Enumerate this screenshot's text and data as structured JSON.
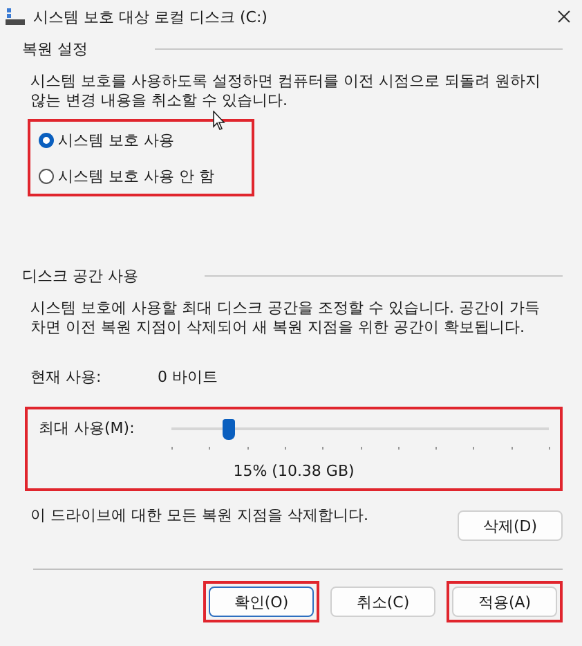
{
  "window": {
    "title": "시스템 보호 대상 로컬 디스크 (C:)"
  },
  "restore_settings": {
    "heading": "복원 설정",
    "description": "시스템 보호를 사용하도록 설정하면 컴퓨터를 이전 시점으로 되돌려 원하지 않는 변경 내용을 취소할 수 있습니다.",
    "highlighted": true,
    "options": [
      {
        "label": "시스템 보호 사용",
        "selected": true
      },
      {
        "label": "시스템 보호 사용 안 함",
        "selected": false
      }
    ]
  },
  "disk_space": {
    "heading": "디스크 공간 사용",
    "description": "시스템 보호에 사용할 최대 디스크 공간을 조정할 수 있습니다. 공간이 가득 차면 이전 복원 지점이 삭제되어 새 복원 지점을 위한 공간이 확보됩니다.",
    "current_label": "현재 사용:",
    "current_value": "0 바이트",
    "max_label": "최대 사용(M):",
    "level": 0.15,
    "reading": "15% (10.38 GB)",
    "highlighted": true
  },
  "delete": {
    "text": "이 드라이브에 대한 모든 복원 지점을 삭제합니다.",
    "button": "삭제(D)"
  },
  "buttons": [
    {
      "label": "확인(O)",
      "default": true,
      "highlighted": true
    },
    {
      "label": "취소(C)",
      "default": false,
      "highlighted": false
    },
    {
      "label": "적용(A)",
      "default": false,
      "highlighted": true
    }
  ]
}
